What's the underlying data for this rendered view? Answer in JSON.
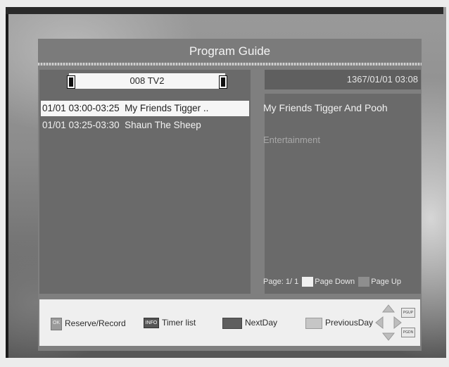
{
  "header": {
    "title": "Program Guide"
  },
  "channel": {
    "name": "008 TV2"
  },
  "datetime": "1367/01/01 03:08",
  "programs": [
    {
      "time": "01/01 03:00-03:25",
      "title": "My Friends Tigger .."
    },
    {
      "time": "01/01 03:25-03:30",
      "title": "Shaun The Sheep"
    }
  ],
  "details": {
    "title": "My Friends Tigger And Pooh",
    "genre": "Entertainment"
  },
  "pager": {
    "label": "Page:",
    "current": "1",
    "separator": "/",
    "total": "1",
    "page_down": "Page Down",
    "page_up": "Page Up"
  },
  "footer": {
    "ok_key": "OK",
    "reserve_record": "Reserve/Record",
    "info_key": "INFO",
    "timer_list": "Timer list",
    "next_day": "NextDay",
    "previous_day": "PreviousDay",
    "pgup_key": "PGUP",
    "pgdn_key": "PGDN"
  },
  "colors": {
    "panel": "#6a6a6a",
    "header": "#7b7b7b",
    "selected_row": "#f6f6f6",
    "footer": "#efefef"
  },
  "icons": [
    "left-arrow-icon",
    "right-arrow-icon",
    "dpad-icon",
    "ok-key-icon",
    "info-key-icon",
    "red-key-icon",
    "yellow-key-icon"
  ]
}
